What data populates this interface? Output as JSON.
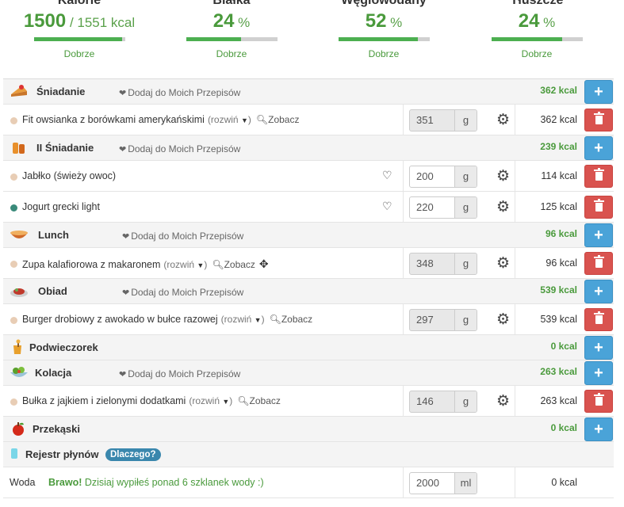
{
  "summary": [
    {
      "title": "Kalorie",
      "value": "1500",
      "unit": " / 1551 kcal",
      "status": "Dobrze",
      "progress": 0.97
    },
    {
      "title": "Białka",
      "value": "24",
      "unit": " %",
      "status": "Dobrze",
      "progress": 0.6
    },
    {
      "title": "Węglowodany",
      "value": "52",
      "unit": " %",
      "status": "Dobrze",
      "progress": 0.87
    },
    {
      "title": "Tłuszcze",
      "value": "24",
      "unit": " %",
      "status": "Dobrze",
      "progress": 0.78
    }
  ],
  "meals": [
    {
      "name": "Śniadanie",
      "add_recipe": "Dodaj do Moich Przepisów",
      "kcal": "362 kcal",
      "icon": "pie-icon"
    },
    {
      "name": "II Śniadanie",
      "add_recipe": "Dodaj do Moich Przepisów",
      "kcal": "239 kcal",
      "icon": "bread-icon"
    },
    {
      "name": "Lunch",
      "add_recipe": "Dodaj do Moich Przepisów",
      "kcal": "96 kcal",
      "icon": "soup-icon"
    },
    {
      "name": "Obiad",
      "add_recipe": "Dodaj do Moich Przepisów",
      "kcal": "539 kcal",
      "icon": "dinner-icon"
    },
    {
      "name": "Podwieczorek",
      "kcal": "0 kcal",
      "icon": "honey-icon"
    },
    {
      "name": "Kolacja",
      "add_recipe": "Dodaj do Moich Przepisów",
      "kcal": "263 kcal",
      "icon": "salad-icon"
    },
    {
      "name": "Przekąski",
      "kcal": "0 kcal",
      "icon": "apple-icon"
    }
  ],
  "foods": [
    {
      "name": "Fit owsianka z borówkami amerykańskimi",
      "rozwin": "(rozwiń",
      "zobacz": "Zobacz",
      "qty": "351",
      "unit": "g",
      "kcal": "362 kcal"
    },
    {
      "name": "Jabłko (świeży owoc)",
      "qty": "200",
      "unit": "g",
      "kcal": "114 kcal"
    },
    {
      "name": "Jogurt grecki light",
      "qty": "220",
      "unit": "g",
      "kcal": "125 kcal"
    },
    {
      "name": "Zupa kalafiorowa z makaronem",
      "rozwin": "(rozwiń",
      "zobacz": "Zobacz",
      "qty": "348",
      "unit": "g",
      "kcal": "96 kcal"
    },
    {
      "name": "Burger drobiowy z awokado w bułce razowej",
      "rozwin": "(rozwiń",
      "zobacz": "Zobacz",
      "qty": "297",
      "unit": "g",
      "kcal": "539 kcal"
    },
    {
      "name": "Bułka z jajkiem i zielonymi dodatkami",
      "rozwin": "(rozwiń",
      "zobacz": "Zobacz",
      "qty": "146",
      "unit": "g",
      "kcal": "263 kcal"
    }
  ],
  "fluids": {
    "title": "Rejestr płynów",
    "why": "Dlaczego?",
    "water_label": "Woda",
    "bravo": "Brawo!",
    "message": " Dzisiaj wypiłeś ponad 6 szklanek wody :)",
    "qty": "2000",
    "unit": "ml",
    "kcal": "0 kcal"
  },
  "buttons": {
    "add": "+"
  },
  "colors": {
    "accent_green": "#4a9a3c",
    "add_blue": "#4aa3d8",
    "delete_red": "#d9534f"
  }
}
